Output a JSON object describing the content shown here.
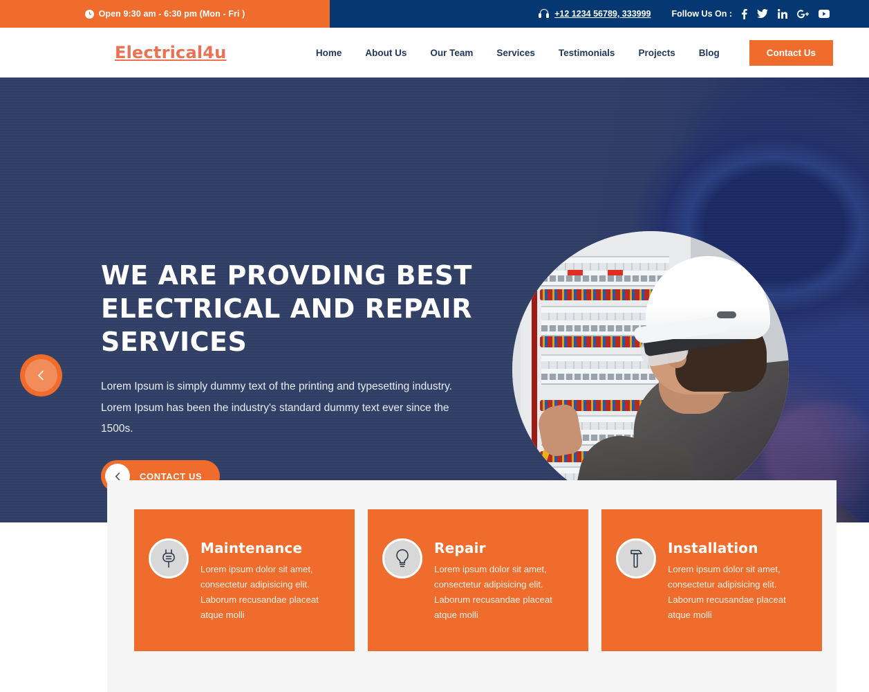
{
  "topbar": {
    "hours": "Open 9:30 am - 6:30 pm (Mon - Fri )",
    "clock_icon": "clock-icon",
    "phone": "+12 1234 56789, 333999",
    "phone_icon": "headset-icon",
    "follow_label": "Follow Us On :",
    "social": [
      {
        "name": "facebook-icon",
        "title": "Facebook"
      },
      {
        "name": "twitter-icon",
        "title": "Twitter"
      },
      {
        "name": "linkedin-icon",
        "title": "LinkedIn"
      },
      {
        "name": "googleplus-icon",
        "title": "Google Plus"
      },
      {
        "name": "youtube-icon",
        "title": "YouTube"
      }
    ],
    "bg_orange": "#ef6c2c",
    "bg_navy": "#053873"
  },
  "header": {
    "logo": "Electrical4u",
    "logo_color": "#ec7153",
    "nav": [
      {
        "label": "Home"
      },
      {
        "label": "About Us"
      },
      {
        "label": "Our Team"
      },
      {
        "label": "Services"
      },
      {
        "label": "Testimonials"
      },
      {
        "label": "Projects"
      },
      {
        "label": "Blog"
      }
    ],
    "cta_label": "Contact Us",
    "cta_color": "#ef6c2c"
  },
  "hero": {
    "title": "WE ARE PROVDING BEST ELECTRICAL AND REPAIR SERVICES",
    "paragraph": "Lorem Ipsum is simply dummy text of the printing and typesetting industry. Lorem Ipsum has been the industry's standard dummy text ever since the 1500s.",
    "button_label": "CONTACT US",
    "button_icon": "chevron-left-icon",
    "prev_icon": "chevron-left-icon",
    "bg_color": "#313f66",
    "photo_alt": "electrician-working-on-breaker-panel"
  },
  "services": [
    {
      "icon": "plug-icon",
      "title": "Maintenance",
      "text": "Lorem ipsum dolor sit amet, consectetur adipisicing elit. Laborum recusandae placeat atque molli"
    },
    {
      "icon": "lightbulb-icon",
      "title": "Repair",
      "text": "Lorem ipsum dolor sit amet, consectetur adipisicing elit. Laborum recusandae placeat atque molli"
    },
    {
      "icon": "hammer-icon",
      "title": "Installation",
      "text": "Lorem ipsum dolor sit amet, consectetur adipisicing elit. Laborum recusandae placeat atque molli"
    }
  ]
}
